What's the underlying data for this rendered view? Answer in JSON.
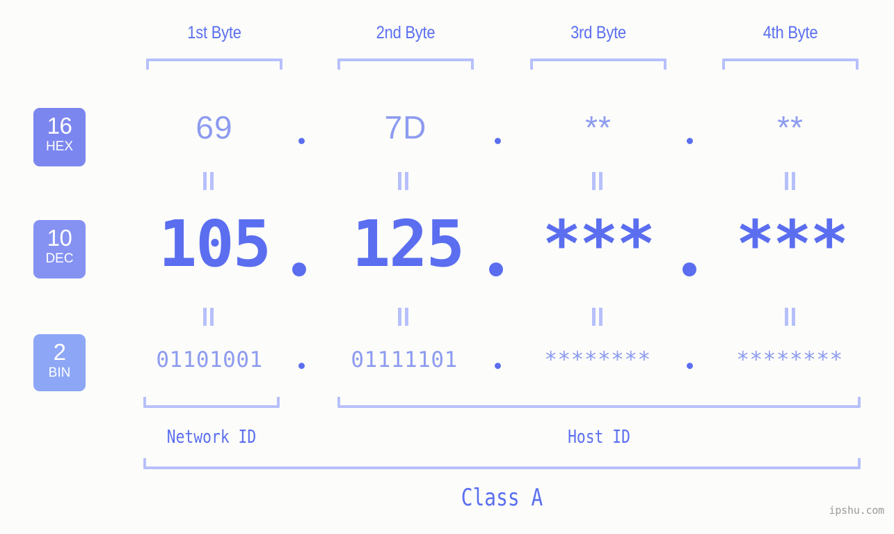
{
  "meta": {
    "background_color": "#fcfdfa",
    "accent_color": "#5b6ef0",
    "light_accent_color": "#8d9bf0",
    "bracket_color": "#b7c0fb",
    "watermark": "ipshu.com"
  },
  "byte_headers": [
    {
      "label": "1st Byte"
    },
    {
      "label": "2nd Byte"
    },
    {
      "label": "3rd Byte"
    },
    {
      "label": "4th Byte"
    }
  ],
  "radix_badges": [
    {
      "number": "16",
      "name": "HEX",
      "color": "#7b86ee"
    },
    {
      "number": "10",
      "name": "DEC",
      "color": "#8592f2"
    },
    {
      "number": "2",
      "name": "BIN",
      "color": "#8da6f5"
    }
  ],
  "rows": {
    "hex": {
      "radix": "16",
      "radix_name": "HEX",
      "octets": [
        "69",
        "7D",
        "**",
        "**"
      ]
    },
    "dec": {
      "radix": "10",
      "radix_name": "DEC",
      "octets": [
        "105",
        "125",
        "***",
        "***"
      ]
    },
    "bin": {
      "radix": "2",
      "radix_name": "BIN",
      "octets": [
        "01101001",
        "01111101",
        "********",
        "********"
      ]
    }
  },
  "separators": {
    "dot": "."
  },
  "equals_marks": {
    "count_per_gap": 4,
    "glyph": "="
  },
  "id_labels": [
    {
      "label": "Network ID"
    },
    {
      "label": "Host ID"
    }
  ],
  "class_label": "Class A"
}
